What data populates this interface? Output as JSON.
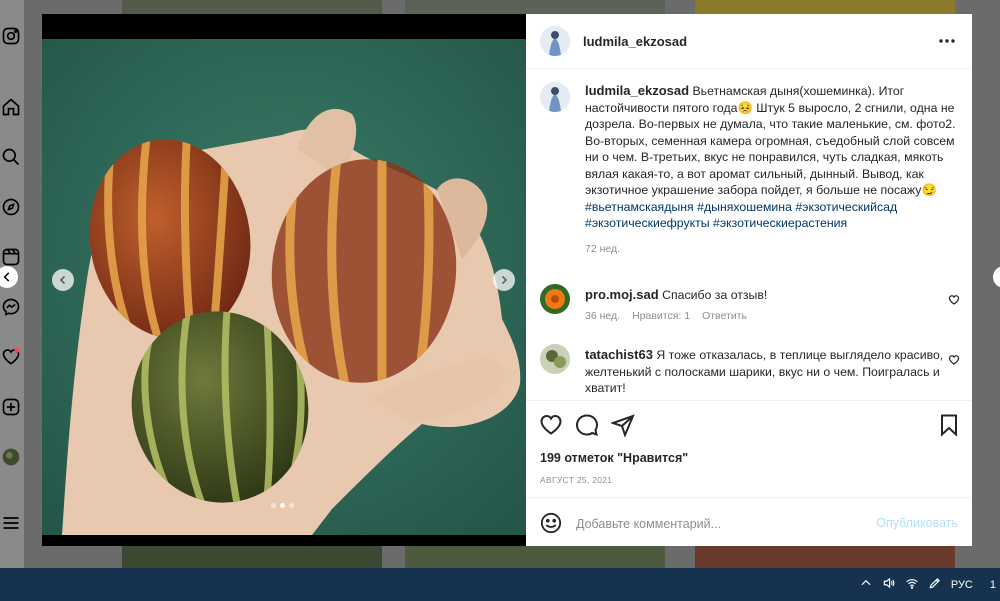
{
  "post": {
    "username": "ludmila_ekzosad",
    "more_icon": "more-horizontal-icon",
    "caption": {
      "username": "ludmila_ekzosad",
      "text": "Вьетнамская дыня(хошеминка). Итог настойчивости пятого года😣 Штук 5 выросло, 2 сгнили, одна не дозрела. Во-первых не думала, что такие маленькие, см. фото2. Во-вторых, семенная камера огромная, съедобный слой совсем ни о чем. В-третьих, вкус не понравился, чуть сладкая, мякоть вялая какая-то, а вот аромат сильный, дынный. Вывод, как экзотичное украшение забора пойдет, я больше не посажу😏",
      "hashtags": "#вьетнамскаядыня #дыняхошемина #экзотическийсад #экзотическиефрукты #экзотическиерастения",
      "age": "72 нед."
    },
    "comments": [
      {
        "username": "pro.moj.sad",
        "text": "Спасибо за отзыв!",
        "age": "36 нед.",
        "likes": "Нравится: 1",
        "reply": "Ответить"
      },
      {
        "username": "tatachist63",
        "text": "Я тоже отказалась, в теплице выглядело красиво, желтенький с полосками шарики, вкус ни о чем. Поигралась и хватит!"
      }
    ],
    "likes_text": "199 отметок \"Нравится\"",
    "date": "АВГУСТ 25, 2021",
    "add_comment_placeholder": "Добавьте комментарий...",
    "publish_label": "Опубликовать",
    "carousel_total": 3,
    "carousel_active": 2
  },
  "taskbar": {
    "language": "РУС",
    "clock_fragment": "1"
  },
  "colors": {
    "accent_blue": "#0095f6",
    "publish_disabled": "#b2dffc",
    "hashtag": "#00376b",
    "taskbar": "#16324f",
    "notification_dot": "#ed4956"
  }
}
